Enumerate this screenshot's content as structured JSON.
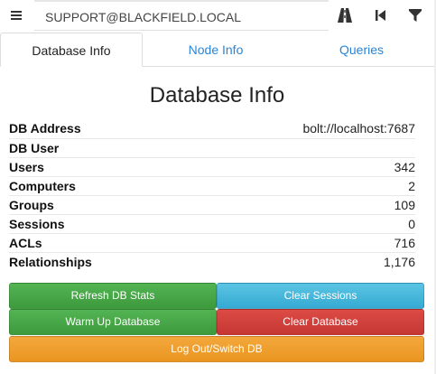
{
  "search": {
    "value": "SUPPORT@BLACKFIELD.LOCAL",
    "placeholder": ""
  },
  "toolbar": {
    "icons": [
      "menu-icon",
      "road-icon",
      "back-to-start-icon",
      "filter-icon"
    ]
  },
  "tabs": [
    {
      "label": "Database Info",
      "active": true
    },
    {
      "label": "Node Info",
      "active": false
    },
    {
      "label": "Queries",
      "active": false
    }
  ],
  "page": {
    "title": "Database Info"
  },
  "stats": [
    {
      "label": "DB Address",
      "value": "bolt://localhost:7687"
    },
    {
      "label": "DB User",
      "value": ""
    },
    {
      "label": "Users",
      "value": "342"
    },
    {
      "label": "Computers",
      "value": "2"
    },
    {
      "label": "Groups",
      "value": "109"
    },
    {
      "label": "Sessions",
      "value": "0"
    },
    {
      "label": "ACLs",
      "value": "716"
    },
    {
      "label": "Relationships",
      "value": "1,176"
    }
  ],
  "buttons": {
    "refresh": "Refresh DB Stats",
    "clear_sessions": "Clear Sessions",
    "warm_up": "Warm Up Database",
    "clear_db": "Clear Database",
    "logout": "Log Out/Switch DB"
  },
  "colors": {
    "link": "#2a85d6",
    "green": "#46a546",
    "blue": "#45b7dc",
    "red": "#d2413c",
    "orange": "#ef9e2c"
  }
}
